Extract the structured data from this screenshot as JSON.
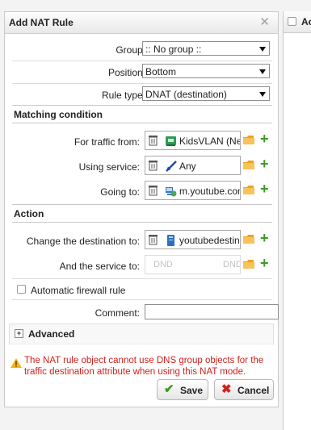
{
  "dialog": {
    "title": "Add NAT Rule",
    "close_glyph": "✕"
  },
  "form": {
    "group": {
      "label": "Group:",
      "value": ":: No group ::"
    },
    "position": {
      "label": "Position:",
      "value": "Bottom"
    },
    "rule_type": {
      "label": "Rule type:",
      "value": "DNAT (destination)"
    }
  },
  "matching": {
    "heading": "Matching condition",
    "traffic_from": {
      "label": "For traffic from:",
      "value": "KidsVLAN (Ne",
      "icon": "network-icon"
    },
    "using_service": {
      "label": "Using service:",
      "value": "Any",
      "icon": "service-any-icon"
    },
    "going_to": {
      "label": "Going to:",
      "value": "m.youtube.com",
      "icon": "dns-host-icon"
    }
  },
  "action": {
    "heading": "Action",
    "change_destination": {
      "label": "Change the destination to:",
      "value": "youtubedestin",
      "icon": "host-icon"
    },
    "and_service": {
      "label": "And the service to:",
      "placeholder_left": "DND",
      "placeholder_right": "DND"
    }
  },
  "automatic_firewall": {
    "label": "Automatic firewall rule",
    "checked": false
  },
  "comment": {
    "label": "Comment:",
    "value": ""
  },
  "advanced": {
    "label": "Advanced",
    "expand_glyph": "+"
  },
  "warning": {
    "text": "The NAT rule object cannot use DNS group objects for the traffic destination attribute when using this NAT mode."
  },
  "buttons": {
    "save": "Save",
    "cancel": "Cancel"
  },
  "right_panel": {
    "title": "Ac"
  },
  "colors": {
    "accent_green": "#3b9b1f",
    "warning_red": "#d0211c",
    "folder_orange": "#f0a21a"
  }
}
